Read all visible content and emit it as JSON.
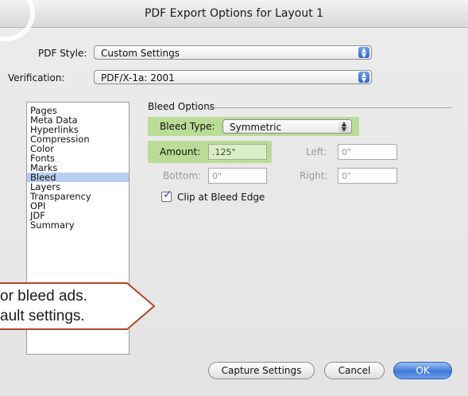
{
  "window": {
    "title": "PDF Export Options for Layout 1"
  },
  "pdf_style": {
    "label": "PDF Style:",
    "value": "Custom Settings"
  },
  "verification": {
    "label": "Verification:",
    "value": "PDF/X-1a: 2001"
  },
  "sidebar": {
    "items": [
      "Pages",
      "Meta Data",
      "Hyperlinks",
      "Compression",
      "Color",
      "Fonts",
      "Marks",
      "Bleed",
      "Layers",
      "Transparency",
      "OPI",
      "JDF",
      "Summary"
    ],
    "selected": "Bleed"
  },
  "bleed_options": {
    "title": "Bleed Options",
    "bleed_type": {
      "label": "Bleed Type:",
      "value": "Symmetric"
    },
    "amount": {
      "label": "Amount:",
      "value": ".125\""
    },
    "left": {
      "label": "Left:",
      "value": "0\""
    },
    "bottom": {
      "label": "Bottom:",
      "value": "0\""
    },
    "right": {
      "label": "Right:",
      "value": "0\""
    },
    "clip": {
      "label": "Clip at Bleed Edge",
      "checked": true
    }
  },
  "callout": {
    "line1": "or bleed ads.",
    "line2": "ault settings."
  },
  "buttons": {
    "capture": "Capture Settings",
    "cancel": "Cancel",
    "ok": "OK"
  },
  "colors": {
    "highlight": "#a9d77a",
    "selection": "#b9cff0",
    "callout_border": "#b0462a",
    "default_button": "#3f78d8"
  }
}
